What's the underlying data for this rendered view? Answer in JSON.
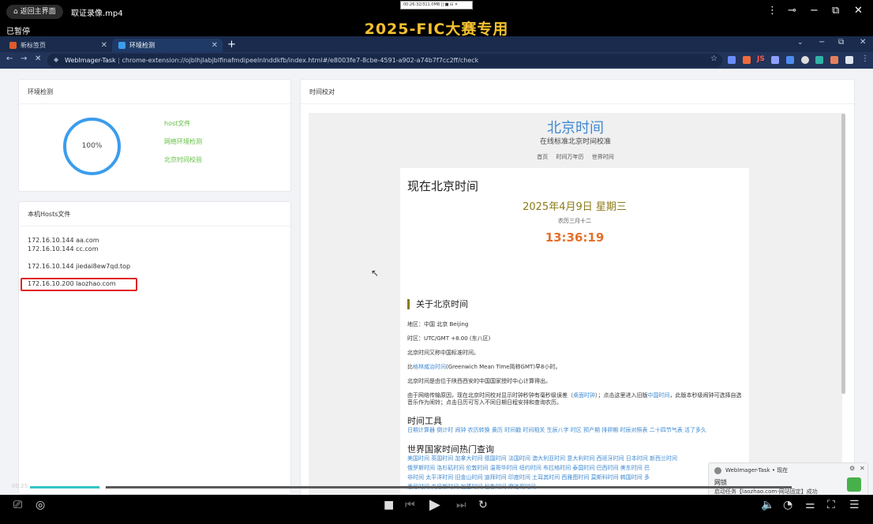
{
  "player": {
    "back_label": "返回主界面",
    "file_name": "取证录像.mp4",
    "status": "已暂停",
    "overlay_title": "2025-FIC大赛专用",
    "rec_toolbar_text": "00:26:32/311.0MB  ||  ■  ⊟  ✕",
    "elapsed": "00:25",
    "progress_fraction": 0.095
  },
  "browser": {
    "tabs": [
      {
        "label": "新标签页",
        "icon_color": "#e05a2b",
        "active": false
      },
      {
        "label": "环境检测",
        "icon_color": "#3b9ded",
        "active": true
      }
    ],
    "url_site": "WebImager-Task",
    "url_path": "chrome-extension://ojblhjlabjblfinafmdipeelnlnddkfb/index.html#/e8003fe7-8cbe-4591-a902-a74b7f7cc2ff/check",
    "extension_icons": [
      "video-icon",
      "camera-icon",
      "js-icon",
      "grid-icon",
      "puzzle-icon",
      "circle-icon",
      "box-icon",
      "hand-icon",
      "extensions-icon"
    ]
  },
  "env_check": {
    "title": "环境检测",
    "percent": "100%",
    "items": [
      "host文件",
      "网络环境检测",
      "北京时间校验"
    ]
  },
  "hosts": {
    "title": "本机Hosts文件",
    "lines": [
      "172.16.10.144 aa.com",
      "172.16.10.144 cc.com",
      "172.16.10.144 jiedai8ew7qd.top",
      "172.16.10.200 laozhao.com"
    ]
  },
  "time_check": {
    "title": "时间校对",
    "site": {
      "head": "北京时间",
      "sub": "在线标准北京时间校准",
      "nav": "首页 时间万年历 世界时间",
      "now_title": "现在北京时间",
      "date": "2025年4月9日 星期三",
      "lunar": "农历三月十二",
      "clock": "13:36:19",
      "about_title": "关于北京时间",
      "region": "地区：中国 北京 Beijing",
      "zone": "时区：UTC/GMT +8.00 (东八区)",
      "p1": "北京时间又称中国标准时间。",
      "p2_pre": "比",
      "p2_link": "格林威治时间",
      "p2_post": "(Greenwich Mean Time简称GMT)早8小时。",
      "p3": "北京时间是由位于陕西西安的中国国家授时中心计算得出。",
      "p4_pre": "由于网络传输原因，现在北京时间校对显示时钟秒钟有毫秒级误差（",
      "p4_link1": "桌面时钟",
      "p4_mid": "）；点击这里进入旧版",
      "p4_link2": "中国时间",
      "p4_post": "，此版本秒级闹钟可选择自选音乐作为闹铃；点击日历可写入不同日期日程安排和查询农历。",
      "tools_title": "时间工具",
      "tools_links": "日期计算器 倒计时 闹钟 农历转换 黄历 时间戳 时间相关 生辰八字 时区 预产期 排卵期 时辰对照表 二十四节气表 活了多久",
      "world_title": "世界国家时间热门查询",
      "world_line1": "美国时间 英国时间 加拿大时间 德国时间 法国时间 澳大利亚时间 意大利时间 西班牙时间 日本时间 新西兰时间",
      "world_line2": "俄罗斯时间 洛杉矶时间 伦敦时间 温哥华时间 纽约时间 布拉格时间 泰国时间 巴西时间 美东时间 巴",
      "world_line3": "非时间 太平洋时间 旧金山时间 迪拜时间 印度时间 土耳其时间 西雅图时间 莫斯科时间 韩国时间 多",
      "world_line4": "悉尼时间 央尼斯时间 加蓬时间 秘鲁时间 摩洛哥时间"
    }
  },
  "notification": {
    "app": "WebImager-Task",
    "when": "• 现在",
    "title": "网锁",
    "body": "启动任务【laozhao.com-网站固定】成功"
  },
  "colors": {
    "accent": "#3b9ded",
    "ok": "#5fbf3e",
    "highlight": "#e02525",
    "overlay": "#f5c030"
  }
}
